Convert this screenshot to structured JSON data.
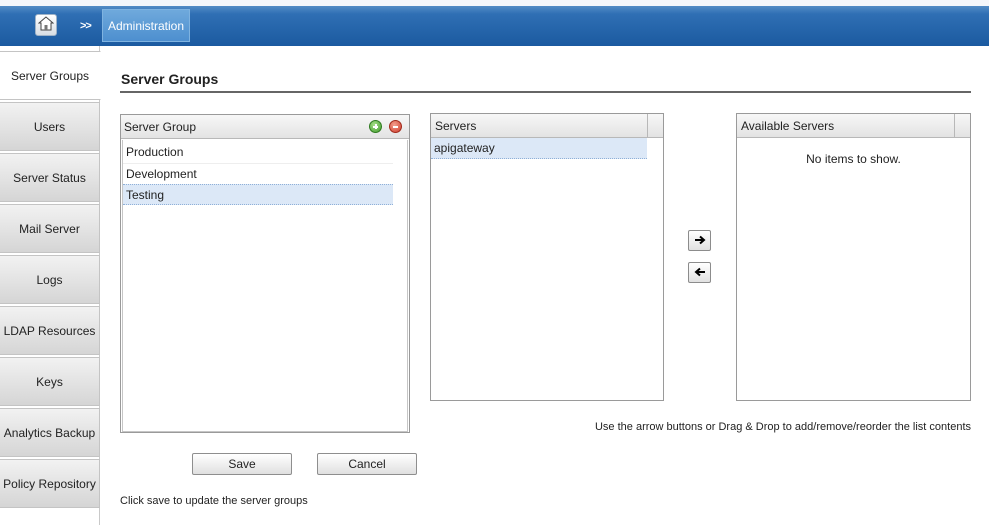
{
  "header": {
    "home_icon": "home-icon",
    "separator": ">>",
    "breadcrumb": "Administration",
    "bar_color": "#1b5aa0"
  },
  "nav": {
    "items": [
      {
        "label": "Server Groups",
        "active": true
      },
      {
        "label": "Users"
      },
      {
        "label": "Server Status"
      },
      {
        "label": "Mail Server"
      },
      {
        "label": "Logs"
      },
      {
        "label": "LDAP Resources"
      },
      {
        "label": "Keys"
      },
      {
        "label": "Analytics Backup"
      },
      {
        "label": "Policy Repository"
      }
    ]
  },
  "main": {
    "title": "Server Groups",
    "groups_panel": {
      "header": "Server Group",
      "add_icon": "add-circle-icon",
      "remove_icon": "remove-circle-icon",
      "rows": [
        "Production",
        "Development",
        "Testing"
      ],
      "selected": "Testing"
    },
    "servers_panel": {
      "header": "Servers",
      "rows": [
        "apigateway"
      ]
    },
    "available_panel": {
      "header": "Available Servers",
      "empty_text": "No items to show."
    },
    "arrow_right_icon": "arrow-right-icon",
    "arrow_left_icon": "arrow-left-icon",
    "hint": "Use the arrow buttons or Drag & Drop to add/remove/reorder the list contents",
    "save_label": "Save",
    "cancel_label": "Cancel",
    "footer_note": "Click save to update the server groups"
  }
}
